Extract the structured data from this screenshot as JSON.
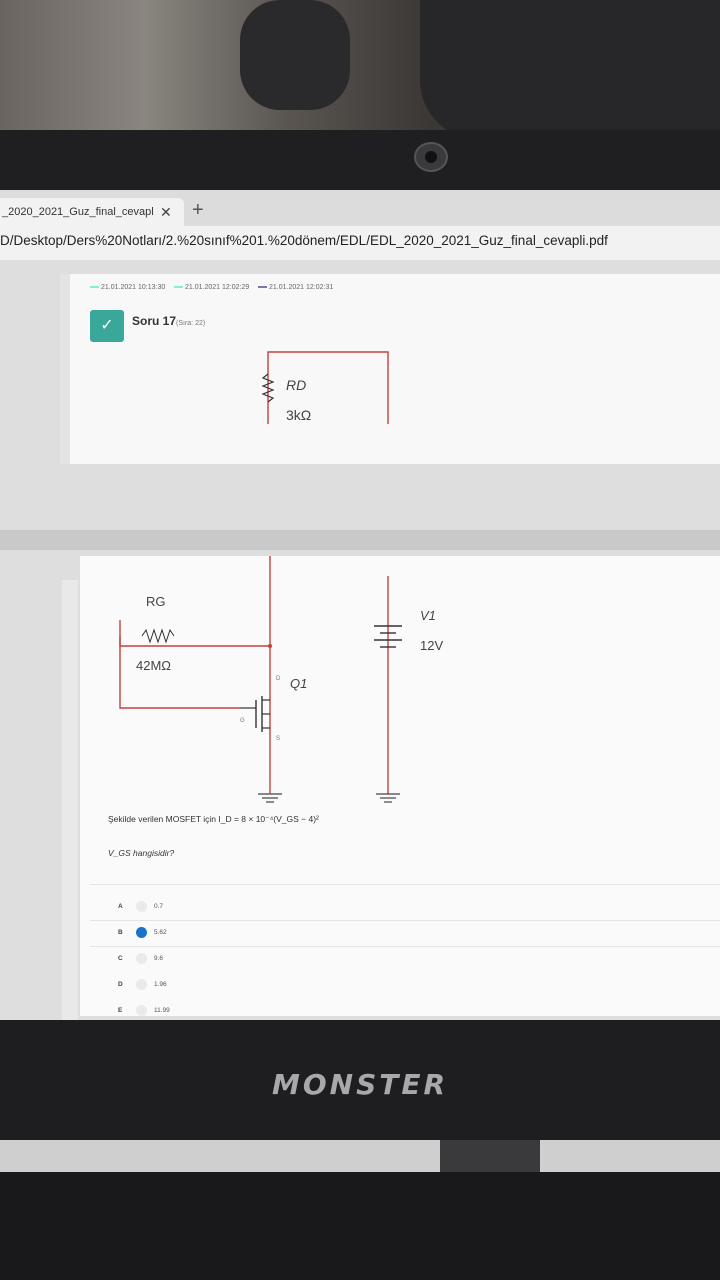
{
  "browser": {
    "tab_title": "_2020_2021_Guz_final_cevapl",
    "tab_close": "✕",
    "new_tab": "+",
    "address": "D/Desktop/Ders%20Notları/2.%20sınıf%201.%20dönem/EDL/EDL_2020_2021_Guz_final_cevapli.pdf"
  },
  "exam": {
    "timestamps": [
      "21.01.2021 10:13:30",
      "21.01.2021 12:02:29",
      "21.01.2021 12:02:31"
    ],
    "check": "✓",
    "question_title": "Soru 17",
    "question_sub": "(Sıra: 22)",
    "circuit": {
      "rd_label": "RD",
      "rd_value": "3kΩ",
      "rg_label": "RG",
      "rg_value": "42MΩ",
      "q_label": "Q1",
      "v_label": "V1",
      "v_value": "12V",
      "d_label": "D",
      "g_label": "G",
      "s_label": "S"
    },
    "question_text": "Şekilde verilen MOSFET için  I_D = 8 × 10⁻⁴(V_GS − 4)²",
    "question_text2": "V_GS hangisidir?",
    "answers": [
      {
        "letter": "A",
        "value": "0.7",
        "selected": false
      },
      {
        "letter": "B",
        "value": "5.62",
        "selected": true
      },
      {
        "letter": "C",
        "value": "9.6",
        "selected": false
      },
      {
        "letter": "D",
        "value": "1.96",
        "selected": false
      },
      {
        "letter": "E",
        "value": "11.99",
        "selected": false
      }
    ]
  },
  "laptop": {
    "brand": "MONSTER"
  }
}
